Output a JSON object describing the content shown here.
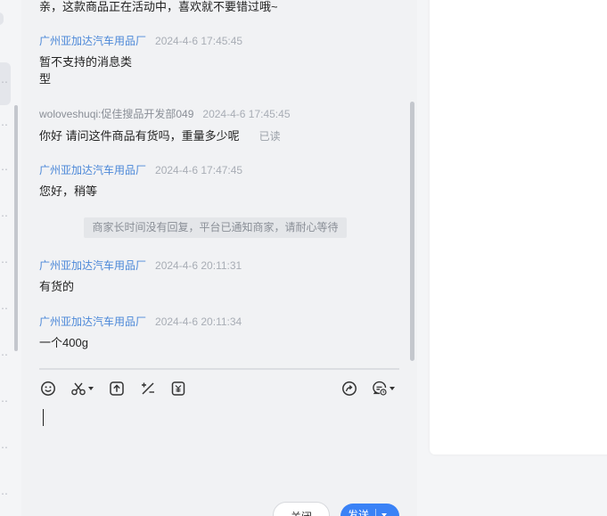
{
  "chat": {
    "messages": [
      {
        "text": "亲，这款商品正在活动中，喜欢就不要错过哦~"
      },
      {
        "sender": "广州亚加达汽车用品厂",
        "time": "2024-4-6 17:45:45",
        "text_line1": "暂不支持的消息类",
        "text_line2": "型"
      },
      {
        "sender": "woloveshuqi:促佳搜品开发部049",
        "time": "2024-4-6 17:45:45",
        "text": "你好 请问这件商品有货吗，重量多少呢",
        "read_status": "已读"
      },
      {
        "sender": "广州亚加达汽车用品厂",
        "time": "2024-4-6 17:47:45",
        "text": "您好，稍等"
      },
      {
        "sender": "广州亚加达汽车用品厂",
        "time": "2024-4-6 20:11:31",
        "text": "有货的"
      },
      {
        "sender": "广州亚加达汽车用品厂",
        "time": "2024-4-6 20:11:34",
        "text": "一个400g"
      }
    ],
    "system_notice": "商家长时间没有回复，平台已通知商家，请耐心等待"
  },
  "toolbar": {
    "left_icons": [
      "emoji-icon",
      "scissors-icon",
      "upload-icon",
      "percent-icon",
      "coupon-icon"
    ],
    "right_icons": [
      "share-icon",
      "quick-reply-icon"
    ]
  },
  "input": {
    "value": ""
  },
  "buttons": {
    "close_label": "关闭",
    "send_label": "发送"
  },
  "colors": {
    "accent": "#3a82f6",
    "seller_name": "#4c88d8"
  }
}
